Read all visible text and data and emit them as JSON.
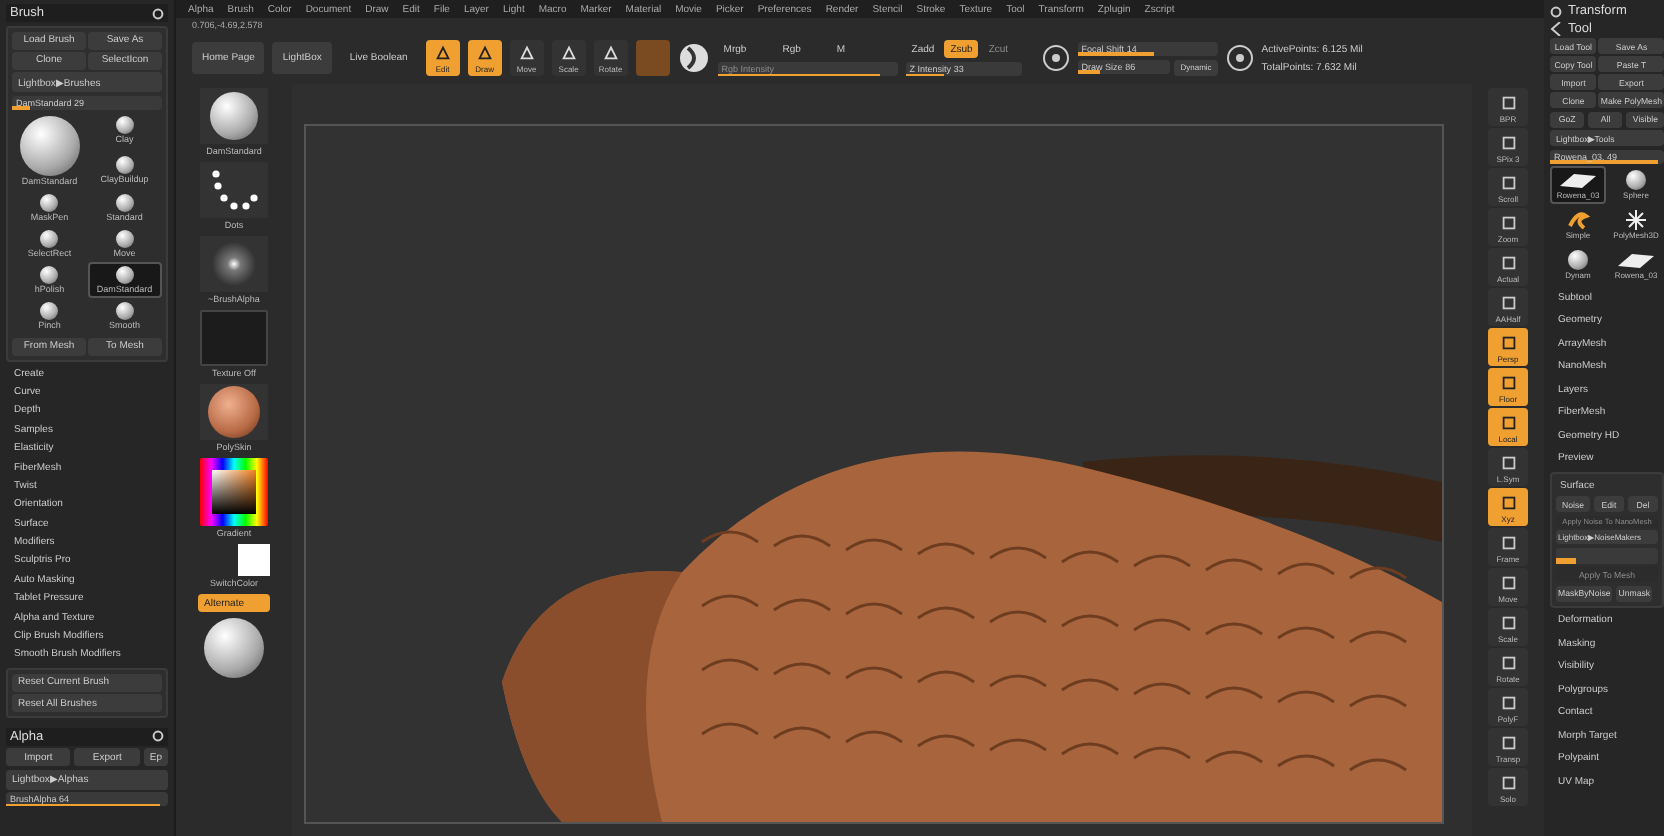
{
  "menu": [
    "Alpha",
    "Brush",
    "Color",
    "Document",
    "Draw",
    "Edit",
    "File",
    "Layer",
    "Light",
    "Macro",
    "Marker",
    "Material",
    "Movie",
    "Picker",
    "Preferences",
    "Render",
    "Stencil",
    "Stroke",
    "Texture",
    "Tool",
    "Transform",
    "Zplugin",
    "Zscript"
  ],
  "coordinates": "0.706,-4.69,2.578",
  "toolbar": {
    "buttons": [
      "Home Page",
      "LightBox",
      "Live Boolean"
    ],
    "modes": [
      {
        "label": "Edit",
        "selected": true
      },
      {
        "label": "Draw",
        "selected": true
      },
      {
        "label": "Move",
        "selected": false
      },
      {
        "label": "Scale",
        "selected": false
      },
      {
        "label": "Rotate",
        "selected": false
      }
    ],
    "color_modes": [
      {
        "label": "Mrgb",
        "selected": false
      },
      {
        "label": "Rgb",
        "selected": false
      },
      {
        "label": "M",
        "selected": false
      }
    ],
    "rgb_intensity": {
      "label": "Rgb Intensity",
      "disabled": true,
      "level": 0.9
    },
    "z_modes": [
      {
        "label": "Zadd",
        "selected": false,
        "disabled": false
      },
      {
        "label": "Zsub",
        "selected": true,
        "disabled": false
      },
      {
        "label": "Zcut",
        "selected": false,
        "disabled": true
      }
    ],
    "z_intensity": {
      "label": "Z Intensity",
      "value": "33",
      "level": 0.33
    },
    "focal_shift": {
      "label": "Focal Shift",
      "value": "14",
      "level": 0.55
    },
    "draw_size": {
      "label": "Draw Size",
      "value": "86",
      "level": 0.25
    },
    "dynamic": "Dynamic",
    "points": [
      "ActivePoints: 6.125 Mil",
      "TotalPoints: 7.632 Mil"
    ]
  },
  "brush_palette": {
    "title": "Brush",
    "buttons": [
      "Load Brush",
      "Save As",
      "Clone",
      "SelectIcon"
    ],
    "lightbox": "Lightbox▶Brushes",
    "slider": {
      "label": "DamStandard",
      "value": "29",
      "level": 0.12
    },
    "current": "DamStandard",
    "brushes": [
      {
        "label": "Clay",
        "selected": false
      },
      {
        "label": "ClayBuildup",
        "selected": false
      },
      {
        "label": "MaskPen",
        "selected": false
      },
      {
        "label": "Standard",
        "selected": false
      },
      {
        "label": "SelectRect",
        "selected": false
      },
      {
        "label": "Move",
        "selected": false
      },
      {
        "label": "hPolish",
        "selected": false
      },
      {
        "label": "DamStandard",
        "selected": true
      },
      {
        "label": "Pinch",
        "selected": false
      },
      {
        "label": "Smooth",
        "selected": false
      }
    ],
    "mesh_buttons": [
      "From Mesh",
      "To Mesh"
    ],
    "sections": [
      "Create",
      "Curve",
      "Depth",
      "Samples",
      "Elasticity",
      "FiberMesh",
      "Twist",
      "Orientation",
      "Surface",
      "Modifiers",
      "Sculptris Pro",
      "Auto Masking",
      "Tablet Pressure",
      "Alpha and Texture",
      "Clip Brush Modifiers",
      "Smooth Brush Modifiers"
    ],
    "reset_buttons": [
      "Reset Current Brush",
      "Reset All Brushes"
    ]
  },
  "alpha_palette": {
    "title": "Alpha",
    "buttons": [
      "Import",
      "Export",
      "Ep"
    ],
    "lightbox": "Lightbox▶Alphas",
    "slider": {
      "label": "BrushAlpha",
      "value": "64",
      "level": 0.95
    }
  },
  "left_shelf": [
    {
      "kind": "brush",
      "label": "DamStandard"
    },
    {
      "kind": "stroke",
      "label": "Dots"
    },
    {
      "kind": "alpha",
      "label": "~BrushAlpha"
    },
    {
      "kind": "texture",
      "label": "Texture Off"
    },
    {
      "kind": "material",
      "label": "PolySkin"
    },
    {
      "kind": "picker",
      "label": "Gradient"
    },
    {
      "kind": "swatch",
      "label": "SwitchColor"
    },
    {
      "kind": "toggle",
      "label": "Alternate",
      "on": true
    },
    {
      "kind": "sphere"
    }
  ],
  "right_shelf": [
    {
      "label": "BPR",
      "on": false
    },
    {
      "label": "SPix 3",
      "on": false
    },
    {
      "label": "Scroll",
      "on": false
    },
    {
      "label": "Zoom",
      "on": false
    },
    {
      "label": "Actual",
      "on": false
    },
    {
      "label": "AAHalf",
      "on": false
    },
    {
      "label": "Persp",
      "on": true
    },
    {
      "label": "Floor",
      "on": true
    },
    {
      "label": "Local",
      "on": true
    },
    {
      "label": "L.Sym",
      "on": false
    },
    {
      "label": "Xyz",
      "on": true
    },
    {
      "label": "Frame",
      "on": false
    },
    {
      "label": "Move",
      "on": false
    },
    {
      "label": "Scale",
      "on": false
    },
    {
      "label": "Rotate",
      "on": false
    },
    {
      "label": "PolyF",
      "on": false
    },
    {
      "label": "Transp",
      "on": false
    },
    {
      "label": "Solo",
      "on": false
    }
  ],
  "tool_palette": {
    "transform_title": "Transform",
    "title": "Tool",
    "buttons": [
      "Load Tool",
      "Save As",
      "Copy Tool",
      "Paste T",
      "Import",
      "Export",
      "Clone",
      "Make PolyMesh"
    ],
    "goz_buttons": [
      "GoZ",
      "All",
      "Visible"
    ],
    "lightbox": "Lightbox▶Tools",
    "slider": {
      "label": "Rowena_03.",
      "value": "49",
      "level": 0.95
    },
    "tools": [
      {
        "kind": "mesh",
        "label": "Rowena_03",
        "selected": true
      },
      {
        "kind": "sphere",
        "label": "Sphere",
        "selected": false
      },
      {
        "kind": "simple",
        "label": "Simple",
        "selected": false
      },
      {
        "kind": "star",
        "label": "PolyMesh3D",
        "selected": false
      },
      {
        "kind": "sphere",
        "label": "Dynam",
        "selected": false
      },
      {
        "kind": "mesh",
        "label": "Rowena_03",
        "selected": false
      }
    ],
    "sections": [
      "Subtool",
      "Geometry",
      "ArrayMesh",
      "NanoMesh",
      "Layers",
      "FiberMesh",
      "Geometry HD",
      "Preview"
    ],
    "surface": {
      "title": "Surface",
      "buttons": [
        "Noise",
        "Edit",
        "Del"
      ],
      "apply_nano": {
        "label": "Apply Noise To NanoMesh",
        "disabled": true
      },
      "lightbox": "Lightbox▶NoiseMakers",
      "level": 0.2,
      "apply_mesh": {
        "label": "Apply To Mesh",
        "disabled": true
      },
      "mask_buttons": [
        "MaskByNoise",
        "Unmask"
      ]
    },
    "more_sections": [
      "Deformation",
      "Masking",
      "Visibility",
      "Polygroups",
      "Contact",
      "Morph Target",
      "Polypaint",
      "UV Map"
    ]
  }
}
